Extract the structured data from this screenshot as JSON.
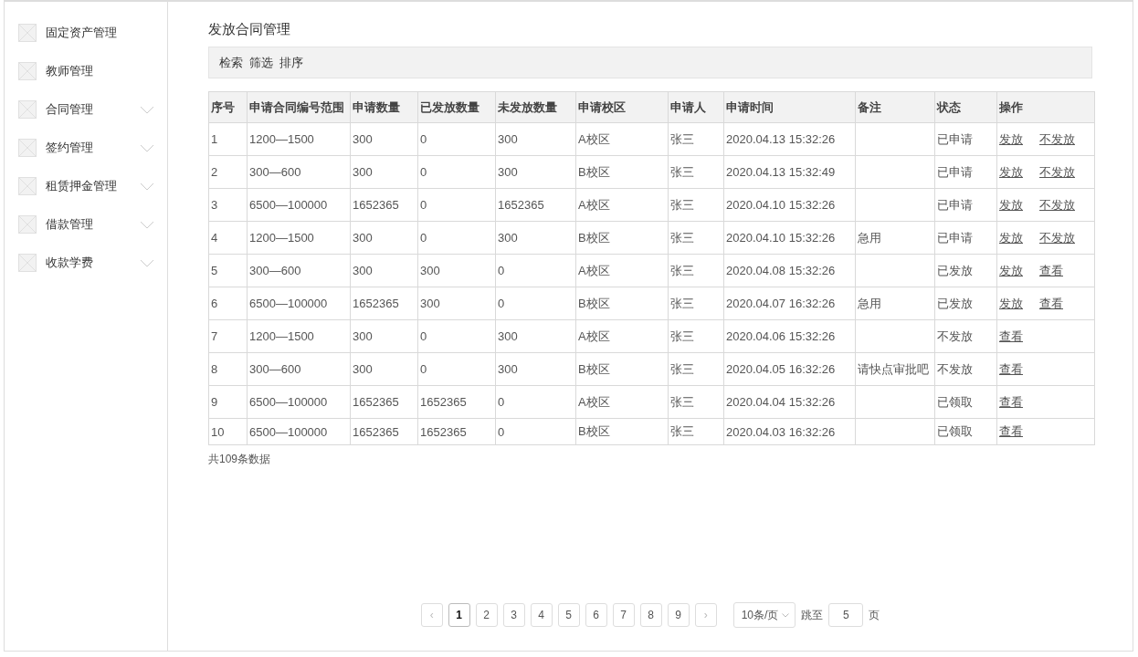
{
  "sidebar": {
    "items": [
      {
        "label": "固定资产管理",
        "kind": "link"
      },
      {
        "label": "教师管理",
        "kind": "link"
      },
      {
        "label": "合同管理",
        "kind": "group"
      },
      {
        "label": "签约管理",
        "kind": "group"
      },
      {
        "label": "租赁押金管理",
        "kind": "group"
      },
      {
        "label": "借款管理",
        "kind": "group"
      },
      {
        "label": "收款学费",
        "kind": "group"
      }
    ]
  },
  "page_title": "发放合同管理",
  "toolbar": [
    "检索",
    "筛选",
    "排序"
  ],
  "table": {
    "columns": [
      "序号",
      "申请合同编号范围",
      "申请数量",
      "已发放数量",
      "未发放数量",
      "申请校区",
      "申请人",
      "申请时间",
      "备注",
      "状态",
      "操作"
    ],
    "rows": [
      {
        "cells": [
          "1",
          "1200—1500",
          "300",
          "0",
          "300",
          "A校区",
          "张三",
          "2020.04.13 15:32:26",
          "",
          "已申请"
        ],
        "actions": [
          "发放",
          "不发放"
        ]
      },
      {
        "cells": [
          "2",
          "300—600",
          "300",
          "0",
          "300",
          "B校区",
          "张三",
          "2020.04.13 15:32:49",
          "",
          "已申请"
        ],
        "actions": [
          "发放",
          "不发放"
        ]
      },
      {
        "cells": [
          "3",
          "6500—100000",
          "1652365",
          "0",
          "1652365",
          "A校区",
          "张三",
          "2020.04.10 15:32:26",
          "",
          "已申请"
        ],
        "actions": [
          "发放",
          "不发放"
        ]
      },
      {
        "cells": [
          "4",
          "1200—1500",
          "300",
          "0",
          "300",
          "B校区",
          "张三",
          "2020.04.10 15:32:26",
          "急用",
          "已申请"
        ],
        "actions": [
          "发放",
          "不发放"
        ]
      },
      {
        "cells": [
          "5",
          "300—600",
          "300",
          "300",
          "0",
          "A校区",
          "张三",
          "2020.04.08 15:32:26",
          "",
          "已发放"
        ],
        "actions": [
          "发放",
          "查看"
        ]
      },
      {
        "cells": [
          "6",
          "6500—100000",
          "1652365",
          "300",
          "0",
          "B校区",
          "张三",
          "2020.04.07 16:32:26",
          "急用",
          "已发放"
        ],
        "actions": [
          "发放",
          "查看"
        ]
      },
      {
        "cells": [
          "7",
          "1200—1500",
          "300",
          "0",
          "300",
          "A校区",
          "张三",
          "2020.04.06 15:32:26",
          "",
          "不发放"
        ],
        "actions": [
          "查看"
        ]
      },
      {
        "cells": [
          "8",
          "300—600",
          "300",
          "0",
          "300",
          "B校区",
          "张三",
          "2020.04.05 16:32:26",
          "请快点审批吧",
          "不发放"
        ],
        "actions": [
          "查看"
        ]
      },
      {
        "cells": [
          "9",
          "6500—100000",
          "1652365",
          "1652365",
          "0",
          "A校区",
          "张三",
          "2020.04.04 15:32:26",
          "",
          "已领取"
        ],
        "actions": [
          "查看"
        ]
      },
      {
        "cells": [
          "10",
          "6500—100000",
          "1652365",
          "1652365",
          "0",
          "B校区",
          "张三",
          "2020.04.03 16:32:26",
          "",
          "已领取"
        ],
        "actions": [
          "查看"
        ]
      }
    ]
  },
  "total": "共109条数据",
  "pagination": {
    "prev": "‹",
    "next": "›",
    "pages": [
      {
        "label": "1",
        "selected": true
      },
      {
        "label": "2",
        "selected": false
      },
      {
        "label": "3",
        "selected": false
      },
      {
        "label": "4",
        "selected": false
      },
      {
        "label": "5",
        "selected": false
      },
      {
        "label": "6",
        "selected": false
      },
      {
        "label": "7",
        "selected": false
      },
      {
        "label": "8",
        "selected": false
      },
      {
        "label": "9",
        "selected": false
      }
    ],
    "page_size": "10条/页",
    "jump_label": "跳至",
    "jump_value": "5",
    "jump_suffix": "页"
  }
}
